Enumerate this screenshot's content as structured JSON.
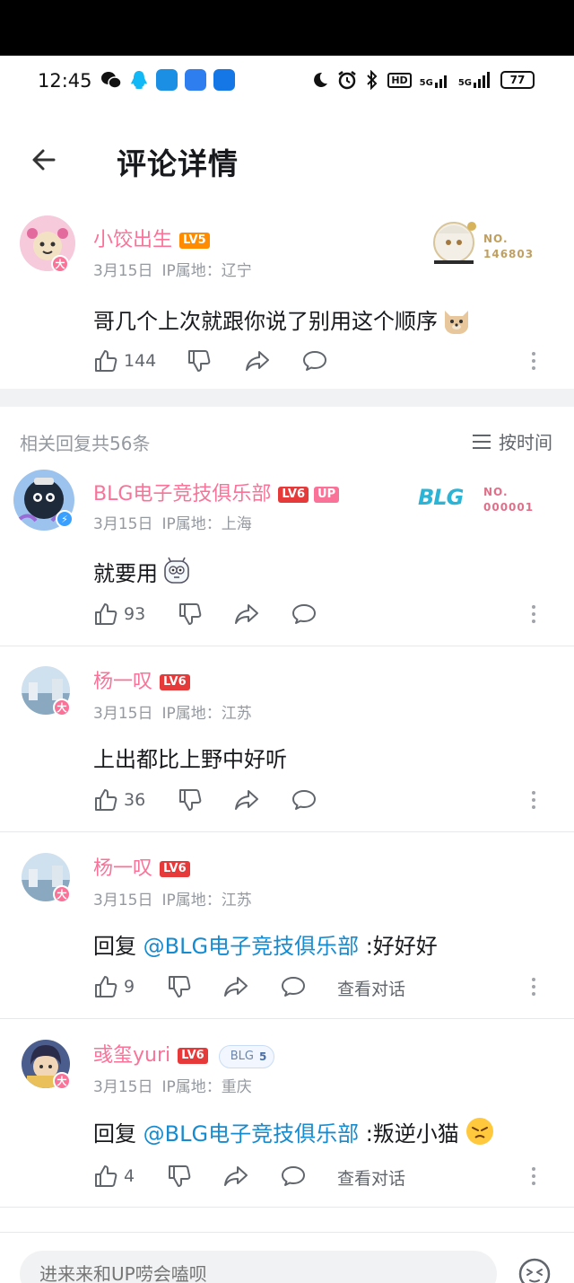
{
  "status_bar": {
    "time": "12:45",
    "battery": "77",
    "icons": [
      "wechat-icon",
      "qq-icon",
      "app-icon",
      "app-icon",
      "app-icon"
    ],
    "right_icons": [
      "moon-icon",
      "alarm-icon",
      "bluetooth-icon",
      "hd-icon",
      "signal-5g-icon",
      "signal-5g-icon"
    ],
    "hd_label": "HD",
    "net1": "5G",
    "net2": "5G"
  },
  "header": {
    "title": "评论详情"
  },
  "root_comment": {
    "username": "小饺出生",
    "level": "LV5",
    "date": "3月15日",
    "ip": "IP属地：辽宁",
    "text": "哥几个上次就跟你说了别用这个顺序",
    "likes": "144",
    "decor_no_line1": "NO.",
    "decor_no_line2": "146803"
  },
  "replies_header": {
    "count_label": "相关回复共56条",
    "sort_label": "按时间"
  },
  "replies": [
    {
      "username": "BLG电子竞技俱乐部",
      "level": "LV6",
      "up_badge": "UP",
      "date": "3月15日",
      "ip": "IP属地：上海",
      "text": "就要用",
      "likes": "93",
      "decor_logo": "BLG",
      "decor_no_line1": "NO.",
      "decor_no_line2": "000001"
    },
    {
      "username": "杨一叹",
      "level": "LV6",
      "date": "3月15日",
      "ip": "IP属地：江苏",
      "text": "上出都比上野中好听",
      "likes": "36"
    },
    {
      "username": "杨一叹",
      "level": "LV6",
      "date": "3月15日",
      "ip": "IP属地：江苏",
      "reply_prefix": "回复 ",
      "mention": "@BLG电子竞技俱乐部",
      "text": " :好好好",
      "likes": "9",
      "view_conversation": "查看对话"
    },
    {
      "username": "彧玺yuri",
      "level": "LV6",
      "fan_badge": "BLG",
      "fan_level": "5",
      "date": "3月15日",
      "ip": "IP属地：重庆",
      "reply_prefix": "回复 ",
      "mention": "@BLG电子竞技俱乐部",
      "text": " :叛逆小猫",
      "likes": "4",
      "view_conversation": "查看对话"
    }
  ],
  "bottom_bar": {
    "placeholder": "进来来和UP唠会嗑呗"
  },
  "colors": {
    "pink": "#fb7299",
    "link": "#178bcf",
    "gray": "#9499a0"
  }
}
